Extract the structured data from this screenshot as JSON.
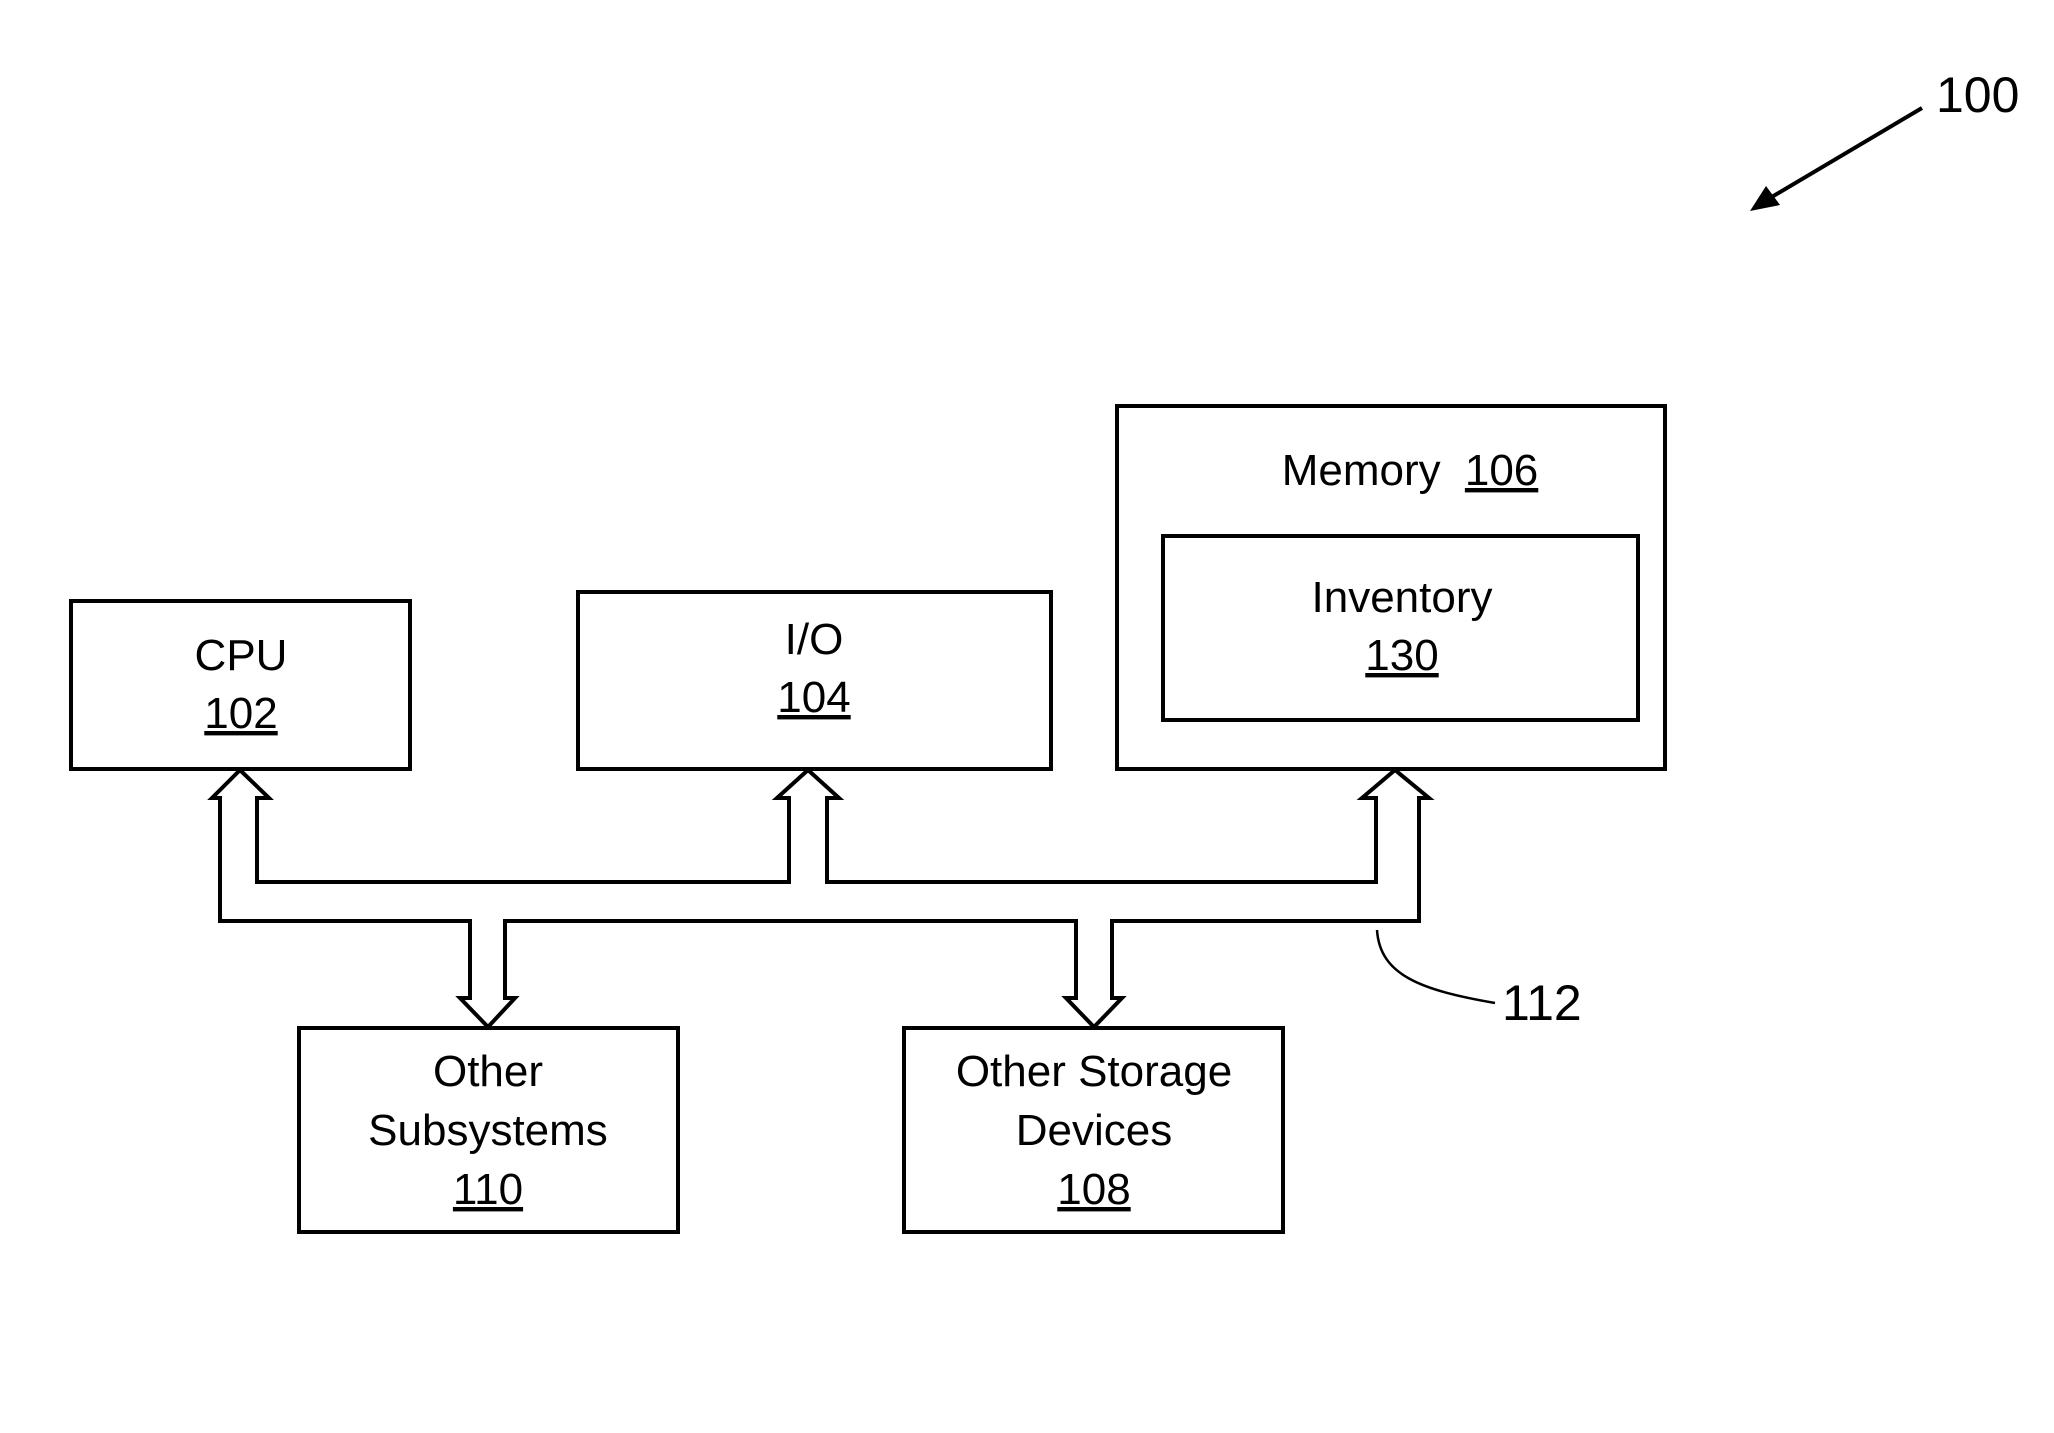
{
  "figure": {
    "reference": "100",
    "bus_reference": "112"
  },
  "components": {
    "cpu": {
      "name": "CPU",
      "number": "102"
    },
    "io": {
      "name": "I/O",
      "number": "104"
    },
    "memory": {
      "name": "Memory",
      "number": "106"
    },
    "inventory": {
      "name": "Inventory",
      "number": "130"
    },
    "other_subsystems": {
      "line1": "Other",
      "line2": "Subsystems",
      "number": "110"
    },
    "other_storage": {
      "line1": "Other Storage",
      "line2": "Devices",
      "number": "108"
    }
  }
}
